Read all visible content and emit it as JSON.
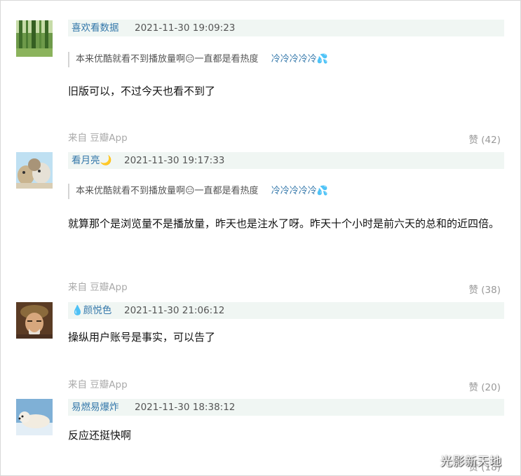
{
  "comments": [
    {
      "username": "喜欢看数据",
      "time": "2021-11-30 19:09:23",
      "quote": {
        "text": "本来优酷就看不到播放量啊😑一直都是看热度",
        "author": "冷冷冷冷冷💦"
      },
      "content": "旧版可以，不过今天也看不到了",
      "source": "来自 豆瓣App",
      "vote": "赞 (42)",
      "avatar_icon": "forest-avatar"
    },
    {
      "username": "看月亮🌙",
      "time": "2021-11-30 19:17:33",
      "quote": {
        "text": "本来优酷就看不到播放量啊😑一直都是看热度",
        "author": "冷冷冷冷冷💦"
      },
      "content": "就算那个是浏览量不是播放量，昨天也是注水了呀。昨天十个小时是前六天的总和的近四倍。",
      "source": "来自 豆瓣App",
      "vote": "赞 (38)",
      "avatar_icon": "cartoon-animals-avatar"
    },
    {
      "username": "💧颜悦色",
      "time": "2021-11-30 21:06:12",
      "content": "操纵用户账号是事实，可以告了",
      "source": "来自 豆瓣App",
      "vote": "赞 (20)",
      "avatar_icon": "man-portrait-avatar"
    },
    {
      "username": "易燃易爆炸",
      "time": "2021-11-30 18:38:12",
      "content": "反应还挺快啊",
      "vote": "赞 (18)",
      "avatar_icon": "polar-bear-avatar"
    }
  ],
  "watermark": "光影新天地",
  "colors": {
    "username": "#3377aa",
    "header_bg": "#f0f6f3",
    "muted": "#aaaaaa"
  }
}
